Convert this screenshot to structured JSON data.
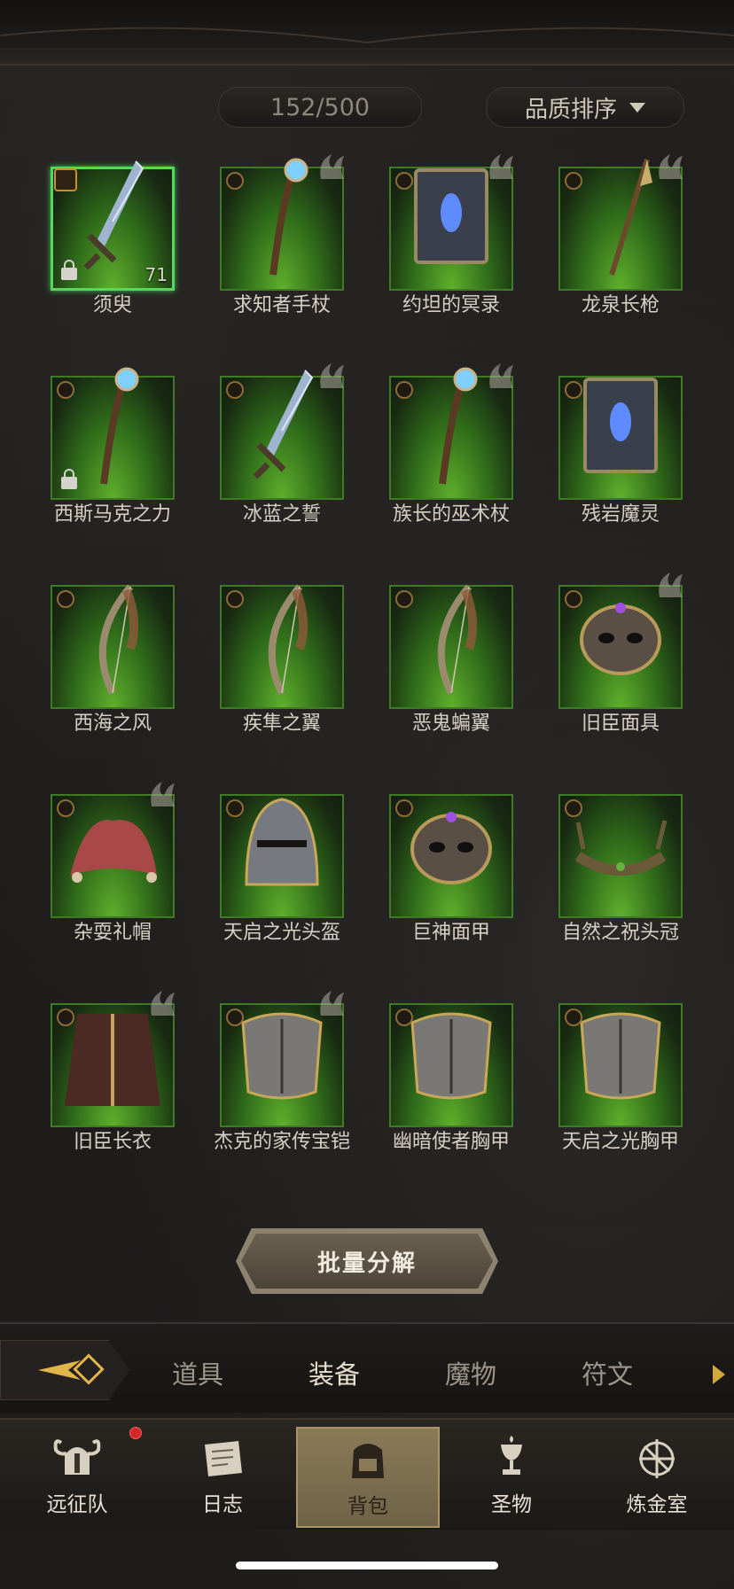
{
  "header": {
    "capacity": "152/500",
    "sort_label": "品质排序"
  },
  "items": [
    {
      "name": "须臾",
      "level": "71",
      "selected": true,
      "equipped": true,
      "locked": true,
      "hero": false,
      "art": "sword-icon"
    },
    {
      "name": "求知者手杖",
      "hero": true,
      "art": "staff-icon"
    },
    {
      "name": "约坦的冥录",
      "hero": true,
      "art": "book-icon"
    },
    {
      "name": "龙泉长枪",
      "hero": true,
      "art": "spear-icon"
    },
    {
      "name": "西斯马克之力",
      "locked": true,
      "hero": false,
      "art": "staff-icon"
    },
    {
      "name": "冰蓝之誓",
      "hero": true,
      "art": "sword-icon"
    },
    {
      "name": "族长的巫术杖",
      "hero": true,
      "art": "staff-icon"
    },
    {
      "name": "残岩魔灵",
      "hero": false,
      "art": "book-icon"
    },
    {
      "name": "西海之风",
      "hero": false,
      "art": "bow-icon"
    },
    {
      "name": "疾隼之翼",
      "hero": false,
      "art": "bow-icon"
    },
    {
      "name": "恶鬼蝙翼",
      "hero": false,
      "art": "bow-icon"
    },
    {
      "name": "旧臣面具",
      "hero": true,
      "art": "mask-icon"
    },
    {
      "name": "杂耍礼帽",
      "hero": true,
      "art": "hat-icon"
    },
    {
      "name": "天启之光头盔",
      "hero": false,
      "art": "helmet-icon"
    },
    {
      "name": "巨神面甲",
      "hero": false,
      "art": "mask-icon"
    },
    {
      "name": "自然之祝头冠",
      "hero": false,
      "art": "crown-icon"
    },
    {
      "name": "旧臣长衣",
      "hero": true,
      "art": "robe-icon"
    },
    {
      "name": "杰克的家传宝铠",
      "hero": true,
      "art": "armor-icon"
    },
    {
      "name": "幽暗使者胸甲",
      "hero": false,
      "art": "armor-icon"
    },
    {
      "name": "天启之光胸甲",
      "hero": false,
      "art": "armor-icon"
    }
  ],
  "actions": {
    "batch_decompose": "批量分解"
  },
  "tabs": [
    {
      "label": "道具"
    },
    {
      "label": "装备",
      "active": true
    },
    {
      "label": "魔物"
    },
    {
      "label": "符文"
    }
  ],
  "nav": [
    {
      "label": "远征队",
      "icon": "viking-helmet-icon",
      "notification": true
    },
    {
      "label": "日志",
      "icon": "scroll-icon"
    },
    {
      "label": "背包",
      "icon": "backpack-icon",
      "active": true
    },
    {
      "label": "圣物",
      "icon": "chalice-icon"
    },
    {
      "label": "炼金室",
      "icon": "alchemy-icon"
    }
  ],
  "colors": {
    "card_green": "#4f9a27",
    "selected_border": "#56d85a",
    "accent_gold": "#d2a83c",
    "notification_red": "#d42828"
  }
}
